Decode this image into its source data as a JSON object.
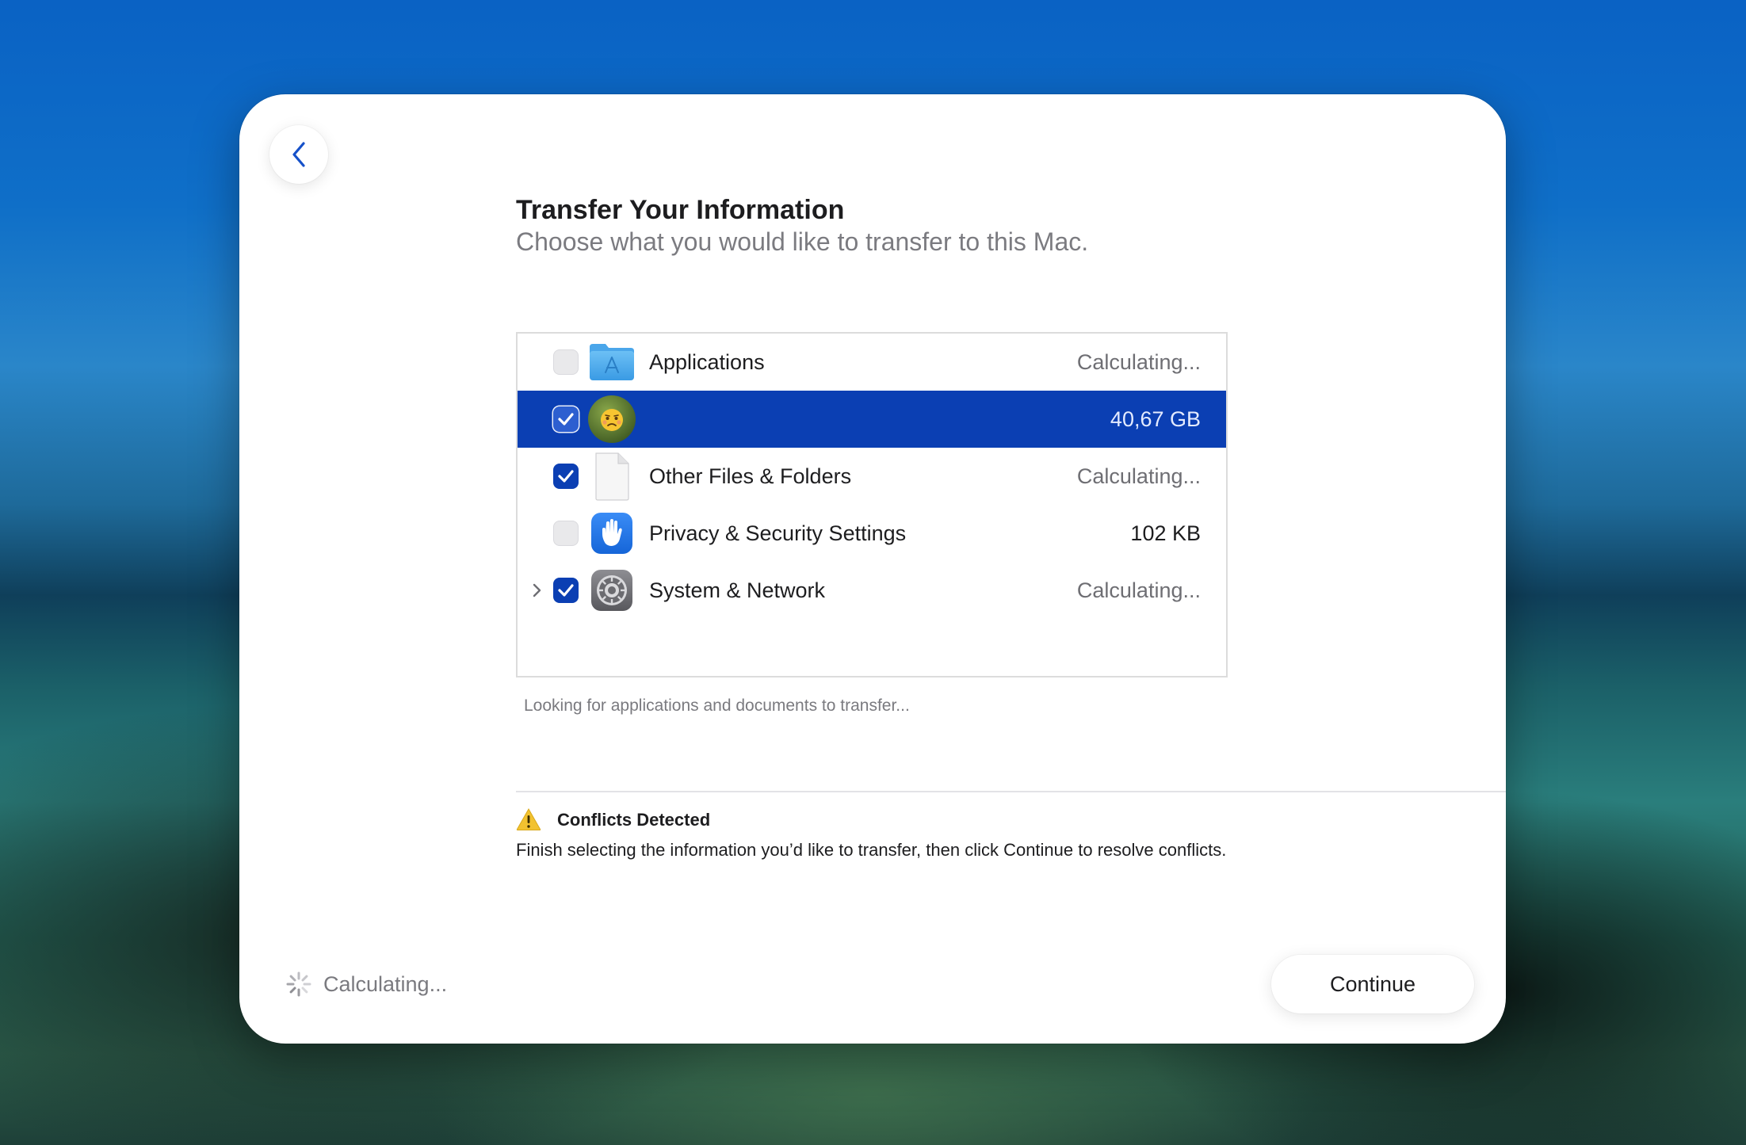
{
  "window": {
    "title": "Transfer Your Information",
    "subtitle": "Choose what you would like to transfer to this Mac."
  },
  "nav": {
    "back_icon": "chevron-left-icon"
  },
  "list": {
    "items": [
      {
        "label": "Applications",
        "size": "Calculating...",
        "checked": false,
        "selected": false,
        "icon": "applications-folder-icon",
        "expandable": false
      },
      {
        "label": "",
        "size": "40,67 GB",
        "checked": true,
        "selected": true,
        "icon": "user-avatar-icon",
        "expandable": false
      },
      {
        "label": "Other Files & Folders",
        "size": "Calculating...",
        "checked": true,
        "selected": false,
        "icon": "document-icon",
        "expandable": false
      },
      {
        "label": "Privacy & Security Settings",
        "size": "102 KB",
        "checked": false,
        "selected": false,
        "icon": "privacy-hand-icon",
        "expandable": false
      },
      {
        "label": "System & Network",
        "size": "Calculating...",
        "checked": true,
        "selected": false,
        "icon": "system-settings-gear-icon",
        "expandable": true
      }
    ],
    "status": "Looking for applications and documents to transfer..."
  },
  "conflicts": {
    "title": "Conflicts Detected",
    "description": "Finish selecting the information you’d like to transfer, then click Continue to resolve conflicts.",
    "icon": "warning-triangle-icon"
  },
  "footer": {
    "status": "Calculating...",
    "continue_label": "Continue"
  },
  "colors": {
    "accent": "#0b3fb3",
    "selection": "#0b3fb3",
    "warning": "#f2c230"
  }
}
